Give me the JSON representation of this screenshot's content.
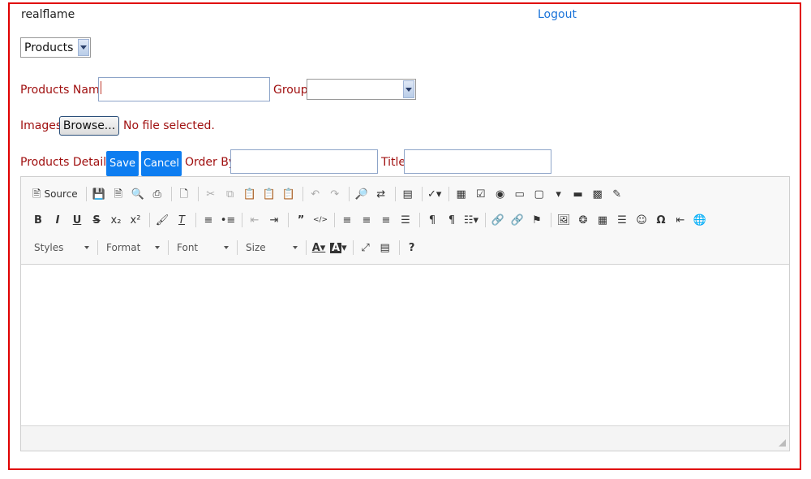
{
  "header": {
    "username": "realflame",
    "logout_label": "Logout"
  },
  "section_select": {
    "selected": "Products"
  },
  "form": {
    "products_name_label": "Products Name",
    "products_name_value": "",
    "group_label": "Group",
    "group_selected": "",
    "images_label": "Images",
    "browse_label": "Browse...",
    "file_status": "No file selected.",
    "details_label": "Products Details :",
    "save_label": "Save",
    "cancel_label": "Cancel",
    "order_by_label": "Order By",
    "order_by_value": "",
    "title_label": "Title",
    "title_value": ""
  },
  "editor": {
    "source_label": "Source",
    "styles_label": "Styles",
    "format_label": "Format",
    "font_label": "Font",
    "size_label": "Size",
    "icons_row1": [
      "source-icon",
      "save-doc-icon",
      "new-page-icon",
      "preview-icon",
      "print-icon",
      "templates-icon",
      "cut-icon",
      "copy-icon",
      "paste-icon",
      "paste-text-icon",
      "paste-word-icon",
      "undo-icon",
      "redo-icon",
      "find-icon",
      "replace-icon",
      "select-all-icon",
      "spellcheck-icon",
      "form-icon",
      "checkbox-icon",
      "radio-icon",
      "textfield-icon",
      "textarea-icon",
      "select-field-icon",
      "button-field-icon",
      "image-button-icon",
      "hidden-field-icon"
    ],
    "icons_row2": [
      "bold-icon",
      "italic-icon",
      "underline-icon",
      "strike-icon",
      "subscript-icon",
      "superscript-icon",
      "copy-format-icon",
      "remove-format-icon",
      "numbered-list-icon",
      "bulleted-list-icon",
      "outdent-icon",
      "indent-icon",
      "blockquote-icon",
      "div-icon",
      "align-left-icon",
      "align-center-icon",
      "align-right-icon",
      "justify-icon",
      "ltr-icon",
      "rtl-icon",
      "language-icon",
      "link-icon",
      "unlink-icon",
      "anchor-icon",
      "image-icon",
      "flash-icon",
      "table-icon",
      "horizontal-rule-icon",
      "smiley-icon",
      "special-char-icon",
      "page-break-icon",
      "iframe-icon"
    ],
    "icons_row3": [
      "text-color-icon",
      "bg-color-icon",
      "maximize-icon",
      "show-blocks-icon",
      "about-icon"
    ]
  }
}
